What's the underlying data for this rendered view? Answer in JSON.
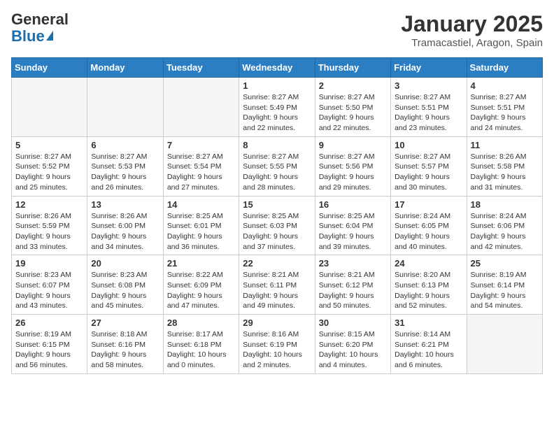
{
  "header": {
    "logo_line1": "General",
    "logo_line2": "Blue",
    "month_year": "January 2025",
    "location": "Tramacastiel, Aragon, Spain"
  },
  "weekdays": [
    "Sunday",
    "Monday",
    "Tuesday",
    "Wednesday",
    "Thursday",
    "Friday",
    "Saturday"
  ],
  "weeks": [
    [
      {
        "num": "",
        "info": ""
      },
      {
        "num": "",
        "info": ""
      },
      {
        "num": "",
        "info": ""
      },
      {
        "num": "1",
        "info": "Sunrise: 8:27 AM\nSunset: 5:49 PM\nDaylight: 9 hours\nand 22 minutes."
      },
      {
        "num": "2",
        "info": "Sunrise: 8:27 AM\nSunset: 5:50 PM\nDaylight: 9 hours\nand 22 minutes."
      },
      {
        "num": "3",
        "info": "Sunrise: 8:27 AM\nSunset: 5:51 PM\nDaylight: 9 hours\nand 23 minutes."
      },
      {
        "num": "4",
        "info": "Sunrise: 8:27 AM\nSunset: 5:51 PM\nDaylight: 9 hours\nand 24 minutes."
      }
    ],
    [
      {
        "num": "5",
        "info": "Sunrise: 8:27 AM\nSunset: 5:52 PM\nDaylight: 9 hours\nand 25 minutes."
      },
      {
        "num": "6",
        "info": "Sunrise: 8:27 AM\nSunset: 5:53 PM\nDaylight: 9 hours\nand 26 minutes."
      },
      {
        "num": "7",
        "info": "Sunrise: 8:27 AM\nSunset: 5:54 PM\nDaylight: 9 hours\nand 27 minutes."
      },
      {
        "num": "8",
        "info": "Sunrise: 8:27 AM\nSunset: 5:55 PM\nDaylight: 9 hours\nand 28 minutes."
      },
      {
        "num": "9",
        "info": "Sunrise: 8:27 AM\nSunset: 5:56 PM\nDaylight: 9 hours\nand 29 minutes."
      },
      {
        "num": "10",
        "info": "Sunrise: 8:27 AM\nSunset: 5:57 PM\nDaylight: 9 hours\nand 30 minutes."
      },
      {
        "num": "11",
        "info": "Sunrise: 8:26 AM\nSunset: 5:58 PM\nDaylight: 9 hours\nand 31 minutes."
      }
    ],
    [
      {
        "num": "12",
        "info": "Sunrise: 8:26 AM\nSunset: 5:59 PM\nDaylight: 9 hours\nand 33 minutes."
      },
      {
        "num": "13",
        "info": "Sunrise: 8:26 AM\nSunset: 6:00 PM\nDaylight: 9 hours\nand 34 minutes."
      },
      {
        "num": "14",
        "info": "Sunrise: 8:25 AM\nSunset: 6:01 PM\nDaylight: 9 hours\nand 36 minutes."
      },
      {
        "num": "15",
        "info": "Sunrise: 8:25 AM\nSunset: 6:03 PM\nDaylight: 9 hours\nand 37 minutes."
      },
      {
        "num": "16",
        "info": "Sunrise: 8:25 AM\nSunset: 6:04 PM\nDaylight: 9 hours\nand 39 minutes."
      },
      {
        "num": "17",
        "info": "Sunrise: 8:24 AM\nSunset: 6:05 PM\nDaylight: 9 hours\nand 40 minutes."
      },
      {
        "num": "18",
        "info": "Sunrise: 8:24 AM\nSunset: 6:06 PM\nDaylight: 9 hours\nand 42 minutes."
      }
    ],
    [
      {
        "num": "19",
        "info": "Sunrise: 8:23 AM\nSunset: 6:07 PM\nDaylight: 9 hours\nand 43 minutes."
      },
      {
        "num": "20",
        "info": "Sunrise: 8:23 AM\nSunset: 6:08 PM\nDaylight: 9 hours\nand 45 minutes."
      },
      {
        "num": "21",
        "info": "Sunrise: 8:22 AM\nSunset: 6:09 PM\nDaylight: 9 hours\nand 47 minutes."
      },
      {
        "num": "22",
        "info": "Sunrise: 8:21 AM\nSunset: 6:11 PM\nDaylight: 9 hours\nand 49 minutes."
      },
      {
        "num": "23",
        "info": "Sunrise: 8:21 AM\nSunset: 6:12 PM\nDaylight: 9 hours\nand 50 minutes."
      },
      {
        "num": "24",
        "info": "Sunrise: 8:20 AM\nSunset: 6:13 PM\nDaylight: 9 hours\nand 52 minutes."
      },
      {
        "num": "25",
        "info": "Sunrise: 8:19 AM\nSunset: 6:14 PM\nDaylight: 9 hours\nand 54 minutes."
      }
    ],
    [
      {
        "num": "26",
        "info": "Sunrise: 8:19 AM\nSunset: 6:15 PM\nDaylight: 9 hours\nand 56 minutes."
      },
      {
        "num": "27",
        "info": "Sunrise: 8:18 AM\nSunset: 6:16 PM\nDaylight: 9 hours\nand 58 minutes."
      },
      {
        "num": "28",
        "info": "Sunrise: 8:17 AM\nSunset: 6:18 PM\nDaylight: 10 hours\nand 0 minutes."
      },
      {
        "num": "29",
        "info": "Sunrise: 8:16 AM\nSunset: 6:19 PM\nDaylight: 10 hours\nand 2 minutes."
      },
      {
        "num": "30",
        "info": "Sunrise: 8:15 AM\nSunset: 6:20 PM\nDaylight: 10 hours\nand 4 minutes."
      },
      {
        "num": "31",
        "info": "Sunrise: 8:14 AM\nSunset: 6:21 PM\nDaylight: 10 hours\nand 6 minutes."
      },
      {
        "num": "",
        "info": ""
      }
    ]
  ]
}
